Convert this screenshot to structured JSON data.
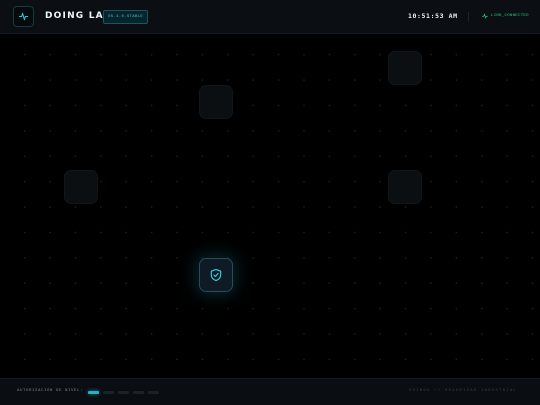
{
  "header": {
    "title": "DOING LAB",
    "version_badge": "OS.4.0.STABLE",
    "clock": "10:51:53 AM",
    "status_text": "LINK_CONNECTED"
  },
  "canvas": {
    "nodes": [
      {
        "name": "ghost-node-1",
        "icon": "none"
      },
      {
        "name": "ghost-node-2",
        "icon": "none"
      },
      {
        "name": "ghost-node-3",
        "icon": "none"
      },
      {
        "name": "ghost-node-4",
        "icon": "none"
      },
      {
        "name": "security-node",
        "icon": "shield-check-icon"
      }
    ]
  },
  "footer": {
    "auth_label": "AUTORIZACIÓN DE NIVEL:",
    "auth_level": 1,
    "auth_levels_total": 5,
    "brand": "DOINGX // SEGURIDAD INDUSTRIAL"
  },
  "colors": {
    "accent": "#22b3c8",
    "status_ok": "#2fd07a",
    "background": "#000000",
    "bar": "#0b0f14"
  }
}
